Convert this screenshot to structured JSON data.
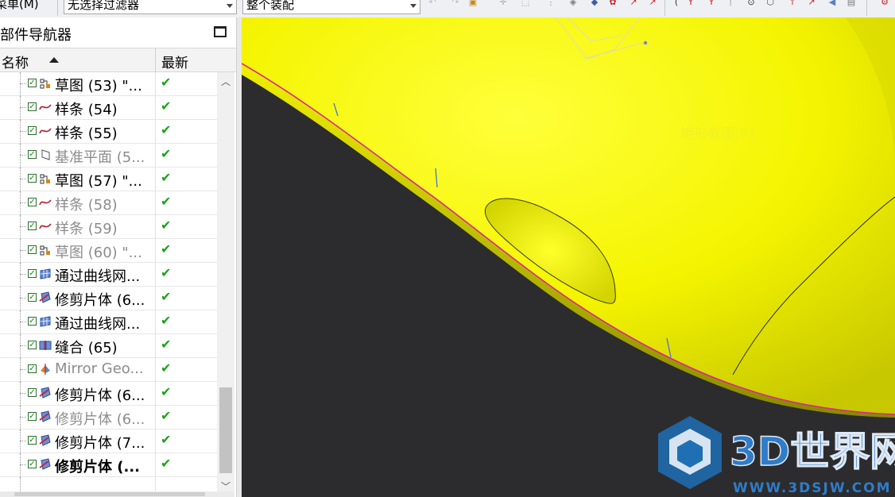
{
  "toolbar": {
    "menu_label": "菜单(M)",
    "filter_combo": "无选择过滤器",
    "scope_combo": "整个装配",
    "icons": [
      "undo-icon",
      "redo-icon",
      "snap-icon",
      "select-icon",
      "wireframe-icon",
      "shaded-icon",
      "filter-icon",
      "edit-curve-icon",
      "point-icon",
      "curve-icon",
      "analysis-icon",
      "constraint-icon",
      "arrow-icon",
      "view-icon",
      "render-icon"
    ]
  },
  "navigator": {
    "title": "部件导航器",
    "col_name": "名称",
    "col_latest": "最新",
    "rows": [
      {
        "label": "草图 (53) \"...",
        "icon": "sketch-icon",
        "dim": false,
        "bold": false,
        "latest": "✔"
      },
      {
        "label": "样条 (54)",
        "icon": "spline-icon",
        "dim": false,
        "bold": false,
        "latest": "✔"
      },
      {
        "label": "样条 (55)",
        "icon": "spline-icon",
        "dim": false,
        "bold": false,
        "latest": "✔"
      },
      {
        "label": "基准平面 (5...",
        "icon": "datum-plane-icon",
        "dim": true,
        "bold": false,
        "latest": "✔"
      },
      {
        "label": "草图 (57) \"...",
        "icon": "sketch-icon",
        "dim": false,
        "bold": false,
        "latest": "✔"
      },
      {
        "label": "样条 (58)",
        "icon": "spline-icon",
        "dim": true,
        "bold": false,
        "latest": "✔"
      },
      {
        "label": "样条 (59)",
        "icon": "spline-icon",
        "dim": true,
        "bold": false,
        "latest": "✔"
      },
      {
        "label": "草图 (60) \"...",
        "icon": "sketch-icon",
        "dim": true,
        "bold": false,
        "latest": "✔"
      },
      {
        "label": "通过曲线网...",
        "icon": "curve-mesh-icon",
        "dim": false,
        "bold": false,
        "latest": "✔"
      },
      {
        "label": "修剪片体 (6...",
        "icon": "trim-sheet-icon",
        "dim": false,
        "bold": false,
        "latest": "✔"
      },
      {
        "label": "通过曲线网...",
        "icon": "curve-mesh-icon",
        "dim": false,
        "bold": false,
        "latest": "✔"
      },
      {
        "label": "缝合 (65)",
        "icon": "sew-icon",
        "dim": false,
        "bold": false,
        "latest": "✔"
      },
      {
        "label": "Mirror Geo...",
        "icon": "mirror-geometry-icon",
        "dim": true,
        "bold": false,
        "latest": "✔"
      },
      {
        "label": "修剪片体 (6...",
        "icon": "trim-sheet-icon",
        "dim": false,
        "bold": false,
        "latest": "✔"
      },
      {
        "label": "修剪片体 (6...",
        "icon": "trim-sheet-icon",
        "dim": true,
        "bold": false,
        "latest": "✔"
      },
      {
        "label": "修剪片体 (7...",
        "icon": "trim-sheet-icon",
        "dim": false,
        "bold": false,
        "latest": "✔"
      },
      {
        "label": "修剪片体 (...",
        "icon": "trim-sheet-icon",
        "dim": false,
        "bold": true,
        "latest": "✔"
      }
    ]
  },
  "viewport": {
    "ghost_label": "矩形截图(R)",
    "surface_color": "#ffff00",
    "background_color": "#2c2c2e",
    "edge_color": "#e0209a"
  },
  "watermark": {
    "brand": "3D世界网",
    "url": "WWW.3DSJW.COM",
    "color": "#2a6fb5"
  }
}
